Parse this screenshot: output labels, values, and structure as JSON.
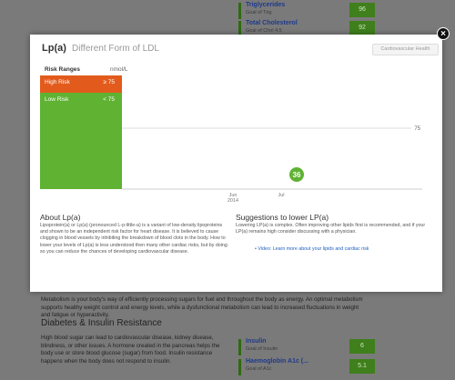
{
  "background": {
    "top_items": [
      {
        "title": "Triglycerides",
        "sub": "Goal of Trig",
        "value": "96"
      },
      {
        "title": "Total Cholesterol",
        "sub": "Goal of Chol 4.5",
        "value": "92"
      }
    ],
    "paragraph": "Metabolism is your body's way of efficiently processing sugars for fuel and throughout the body as energy. An optimal metabolism supports healthy weight control and energy levels, while a dysfunctional metabolism can lead to increased fluctuations in weight and fatigue or hyperactivity.",
    "heading": "Diabetes & Insulin Resistance",
    "paragraph2": "High blood sugar can lead to cardiovascular disease, kidney disease, blindness, or other issues. A hormone created in the pancreas helps the body use or store blood glucose (sugar) from food. Insulin resistance happens when the body does not respond to insulin.",
    "bottom_items": [
      {
        "title": "Insulin",
        "sub": "Goal of Insulin",
        "value": "6"
      },
      {
        "title": "Haemoglobin A1c (...",
        "sub": "Goal of A1c",
        "value": "5.1"
      }
    ]
  },
  "modal": {
    "title": "Lp(a)",
    "subtitle": "Different Form of LDL",
    "tag": "Cardiovascular Health",
    "ranges_header": "Risk Ranges",
    "unit": "nmol/L",
    "ranges": [
      {
        "label": "High Risk",
        "value": "≥ 75"
      },
      {
        "label": "Low Risk",
        "value": "< 75"
      }
    ],
    "about_title": "About Lp(a)",
    "about_text": "Lipoprotein(a) or Lp(a) (pronounced L-p-little-a) is a variant of low-density lipoproteins and shown to be an independent risk factor for heart disease. It is believed to cause clogging in blood vessels by inhibiting the breakdown of blood clots in the body. How to lower your levels of Lp(a) is less understood then many other cardiac risks, but by doing so you can reduce the chances of developing cardiovascular disease.",
    "suggestions_title": "Suggestions to lower LP(a)",
    "suggestions_text": "Lowering LP(a) is complex. Often improving other lipids first is recommended, and if your LP(a) remains high consider discussing with a physician.",
    "suggestion_link": "Video: Learn more about your lipids and cardiac risk"
  },
  "chart_data": {
    "type": "scatter",
    "x_ticks": [
      "Jun\n2014",
      "Jul"
    ],
    "threshold": 75,
    "threshold_label": "75",
    "points": [
      {
        "x": "Jun 2014",
        "y": 36,
        "label": "36"
      }
    ],
    "ylim": [
      0,
      100
    ],
    "colors": {
      "point": "#5fb232",
      "threshold": "#dddddd"
    }
  }
}
